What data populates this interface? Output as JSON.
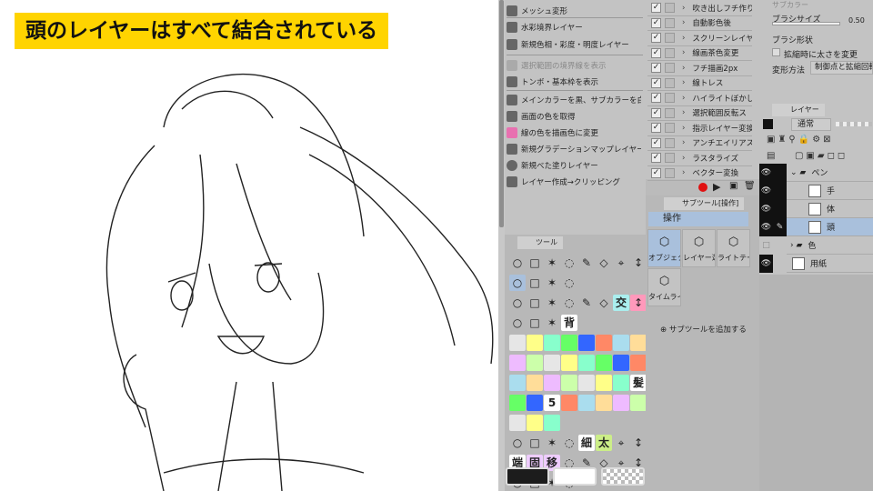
{
  "banner": "頭のレイヤーはすべて結合されている",
  "menu": {
    "items": [
      {
        "label": "メッシュ変形",
        "disabled": false
      },
      {
        "label": "水彩境界レイヤー",
        "disabled": false
      },
      {
        "label": "新規色相・彩度・明度レイヤー",
        "disabled": false
      },
      {
        "label": "選択範囲の境界線を表示",
        "disabled": true
      },
      {
        "label": "トンボ・基本枠を表示",
        "disabled": false
      },
      {
        "label": "メインカラーを黒、サブカラーを白に変更",
        "disabled": false
      },
      {
        "label": "画面の色を取得",
        "disabled": false
      },
      {
        "label": "線の色を描画色に変更",
        "disabled": false
      },
      {
        "label": "新規グラデーションマップレイヤー",
        "disabled": false
      },
      {
        "label": "新規べた塗りレイヤー",
        "disabled": false
      },
      {
        "label": "レイヤー作成→クリッピング",
        "disabled": false
      }
    ]
  },
  "actions": {
    "items": [
      "吹き出しフチ作り(",
      "自動影色後",
      "スクリーンレイヤー(",
      "線画茶色変更",
      "フチ描画2px",
      "線トレス",
      "ハイライトぼかし",
      "選択範囲反転ス",
      "指示レイヤー変換",
      "アンチエイリアスオン",
      "ラスタライズ",
      "ベクター変換"
    ]
  },
  "tool_panel": {
    "tab": "ツール",
    "glyphs": [
      "交",
      "背",
      "5",
      "髪",
      "細",
      "太",
      "端",
      "固",
      "移"
    ]
  },
  "subtool": {
    "tab": "サブツール[操作]",
    "group": "操作",
    "items": [
      "オブジェクト",
      "レイヤー選択",
      "ライトテーブル",
      "タイムライン"
    ],
    "add": "サブツールを追加する"
  },
  "props": {
    "sub_color": "サブカラー",
    "brush_size": "ブラシサイズ",
    "brush_size_value": "0.50",
    "brush_shape": "ブラシ形状",
    "scale_thickness": "拡縮時に太さを変更",
    "transform_method_label": "変形方法",
    "transform_method_value": "制御点と拡縮回転"
  },
  "layers": {
    "tab": "レイヤー",
    "blend_mode": "通常",
    "rows": [
      {
        "name": "ペン",
        "type": "folder",
        "visible": true
      },
      {
        "name": "手",
        "type": "layer",
        "visible": true
      },
      {
        "name": "体",
        "type": "layer",
        "visible": true
      },
      {
        "name": "頭",
        "type": "layer",
        "visible": true,
        "selected": true
      },
      {
        "name": "色",
        "type": "folder",
        "visible": false
      },
      {
        "name": "用紙",
        "type": "paper",
        "visible": true
      }
    ]
  }
}
